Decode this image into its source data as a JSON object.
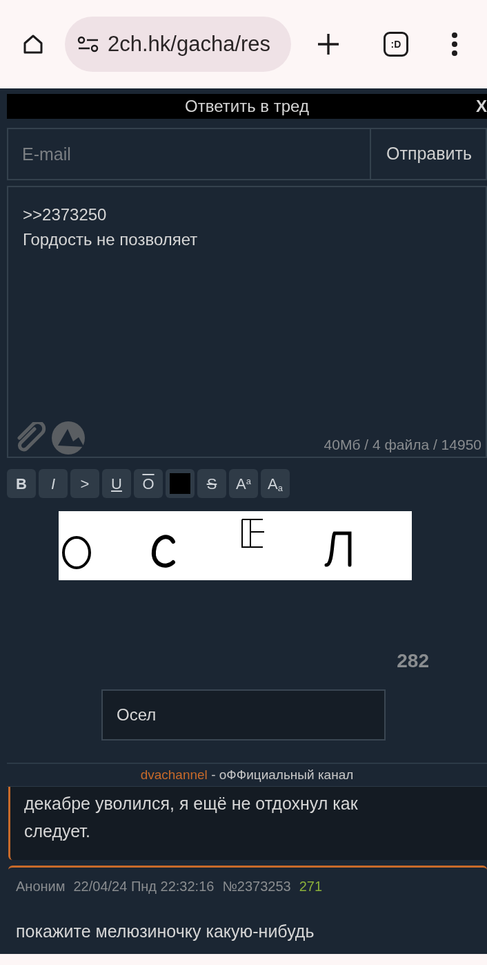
{
  "browser": {
    "url": "2ch.hk/gacha/res",
    "tab_label": ":D"
  },
  "reply_form": {
    "title": "Ответить в тред",
    "close": "X",
    "email": {
      "placeholder": "E-mail"
    },
    "send": "Отправить",
    "message": ">>2373250\nГордость не позволяет",
    "limits": "40Мб / 4 файла / 14950",
    "markup_buttons": [
      {
        "kind": "bold",
        "label": "B"
      },
      {
        "kind": "italic",
        "label": "I"
      },
      {
        "kind": "plain",
        "label": ">"
      },
      {
        "kind": "underline",
        "label": "U"
      },
      {
        "kind": "overline",
        "label": "O"
      },
      {
        "kind": "spoiler"
      },
      {
        "kind": "strike",
        "label": "S"
      },
      {
        "kind": "sup",
        "label": "A",
        "small": "a"
      },
      {
        "kind": "sub",
        "label": "A",
        "small": "a"
      }
    ],
    "counter": "282",
    "captcha_answer": "Осел",
    "footer_link": "dvachannel",
    "footer_text": "- оФФициальный канал"
  },
  "posts": [
    {
      "kind": "quote_tail",
      "text": "декабре уволился, я ещё не отдохнул как следует."
    },
    {
      "kind": "post",
      "author": "Аноним",
      "date": "22/04/24 Пнд 22:32:16",
      "number": "№2373253",
      "index": "271",
      "text": "покажите мелюзиночку какую-нибудь"
    }
  ]
}
